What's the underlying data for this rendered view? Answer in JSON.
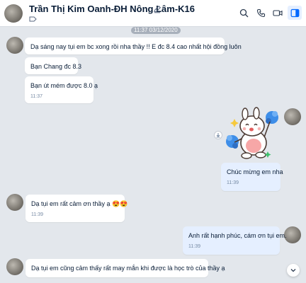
{
  "header": {
    "title": "Trần Thị Kim Oanh-ĐH Nông Lâm-K16",
    "active_color": "#0068ff",
    "icons": [
      "search-icon",
      "phone-icon",
      "video-icon",
      "sidebar-toggle-icon"
    ]
  },
  "chat": {
    "date_separator": "11:37 03/12/2020",
    "messages": [
      {
        "from": "other",
        "text": "Dạ sáng nay tụi em bc xong rồi nha thầy !! E đc 8.4 cao nhất hội đồng luôn",
        "time": ""
      },
      {
        "from": "other",
        "text": "Bạn Chang đc 8.3",
        "time": ""
      },
      {
        "from": "other",
        "text": "Bạn út mém được 8.0 ạ",
        "time": "11:37"
      },
      {
        "from": "me",
        "type": "sticker",
        "sticker": "cheering-bunny"
      },
      {
        "from": "me",
        "text": "Chúc mừng em nha",
        "time": "11:39"
      },
      {
        "from": "other",
        "text": "Dạ tụi em rất cảm ơn thầy ạ 😍😍",
        "time": "11:39"
      },
      {
        "from": "me",
        "text": "Anh rất hạnh phúc, cám ơn tụi em.",
        "time": "11:39"
      },
      {
        "from": "other",
        "text": "Dạ tụi em cũng cảm thấy rất may mắn khi được là học trò của thầy ạ",
        "time": ""
      }
    ]
  }
}
